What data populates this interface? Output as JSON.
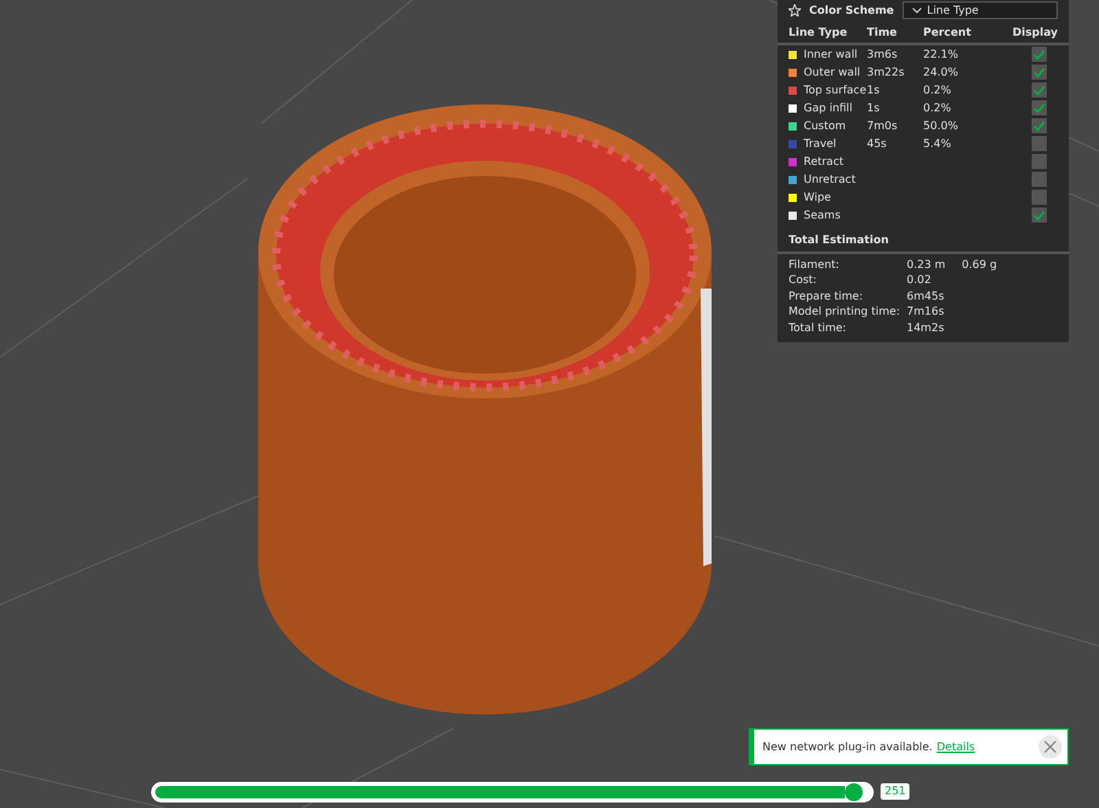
{
  "color_scheme": {
    "label": "Color Scheme",
    "value": "Line Type"
  },
  "legend": {
    "columns": [
      "Line Type",
      "Time",
      "Percent",
      "Display"
    ],
    "rows": [
      {
        "name": "Inner wall",
        "color": "#f0e040",
        "time": "3m6s",
        "percent": "22.1%",
        "display": true
      },
      {
        "name": "Outer wall",
        "color": "#f08040",
        "time": "3m22s",
        "percent": "24.0%",
        "display": true
      },
      {
        "name": "Top surface",
        "color": "#e04848",
        "time": "1s",
        "percent": "0.2%",
        "display": true
      },
      {
        "name": "Gap infill",
        "color": "#ffffff",
        "time": "1s",
        "percent": "0.2%",
        "display": true
      },
      {
        "name": "Custom",
        "color": "#40d090",
        "time": "7m0s",
        "percent": "50.0%",
        "display": true
      },
      {
        "name": "Travel",
        "color": "#3848a8",
        "time": "45s",
        "percent": "5.4%",
        "display": false
      },
      {
        "name": "Retract",
        "color": "#d030d0",
        "display": false
      },
      {
        "name": "Unretract",
        "color": "#40a8d0",
        "display": false
      },
      {
        "name": "Wipe",
        "color": "#ffff00",
        "display": false
      },
      {
        "name": "Seams",
        "color": "#e8e8e8",
        "display": true
      }
    ]
  },
  "total_estimation": {
    "title": "Total Estimation",
    "rows": [
      {
        "label": "Filament:",
        "values": [
          "0.23 m",
          "0.69 g"
        ]
      },
      {
        "label": "Cost:",
        "values": [
          "0.02"
        ]
      },
      {
        "label": "Prepare time:",
        "values": [
          "6m45s"
        ]
      },
      {
        "label": "Model printing time:",
        "values": [
          "7m16s"
        ]
      },
      {
        "label": "Total time:",
        "values": [
          "14m2s"
        ]
      }
    ]
  },
  "notification": {
    "text": "New network plug-in available.",
    "link": "Details"
  },
  "layer_slider": {
    "level": 0.99,
    "value": "251"
  }
}
